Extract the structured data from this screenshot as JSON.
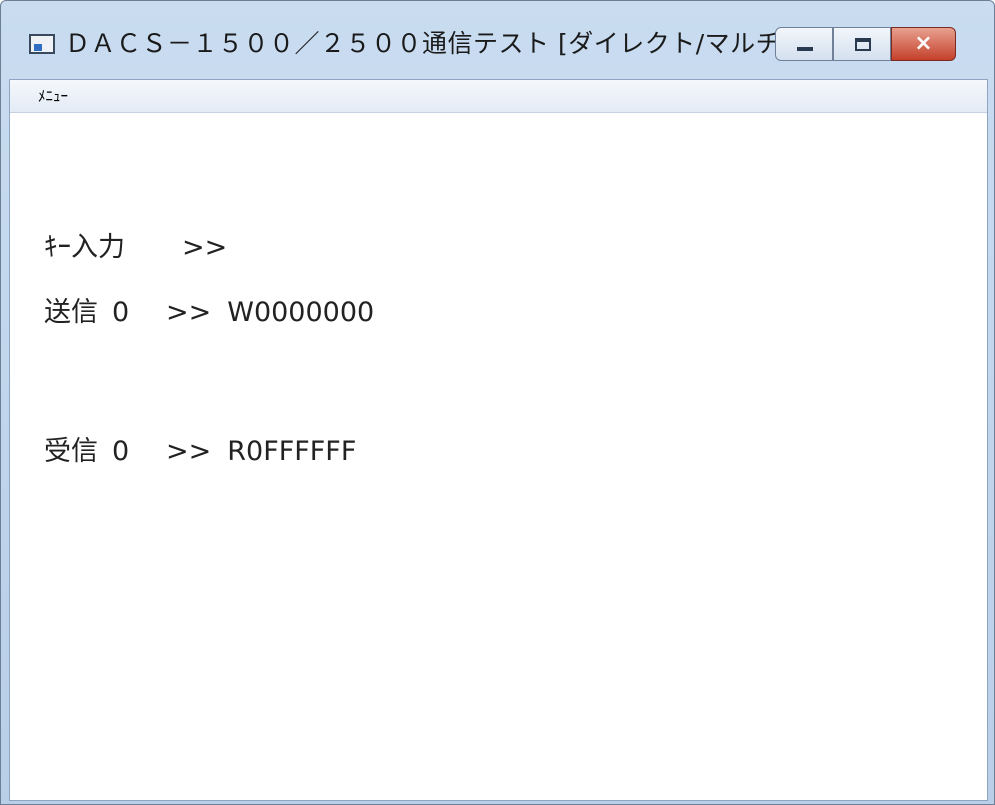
{
  "window": {
    "title": "ＤＡＣＳ－１５００／２５００通信テスト [ダイレクト/マルチ...",
    "controls": {
      "minimize": "minimize-icon",
      "maximize": "maximize-icon",
      "close": "close-icon",
      "close_glyph": "×"
    }
  },
  "menu": {
    "items": [
      {
        "label": "ﾒﾆｭｰ"
      }
    ]
  },
  "console": {
    "key_input": {
      "label": "ｷｰ入力",
      "prompt": ">>",
      "value": ""
    },
    "send": {
      "label": "送信",
      "channel": "0",
      "prompt": ">>",
      "value": "W0000000"
    },
    "receive": {
      "label": "受信",
      "channel": "0",
      "prompt": ">>",
      "value": "R0FFFFFF"
    }
  }
}
